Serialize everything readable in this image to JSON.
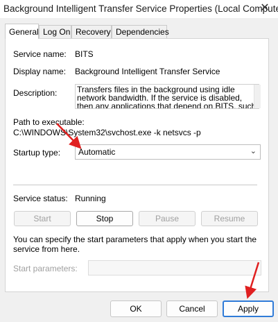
{
  "window": {
    "title": "Background Intelligent Transfer Service Properties (Local Computer)",
    "close_icon": "close-icon"
  },
  "tabs": [
    {
      "label": "General"
    },
    {
      "label": "Log On"
    },
    {
      "label": "Recovery"
    },
    {
      "label": "Dependencies"
    }
  ],
  "general": {
    "service_name_label": "Service name:",
    "service_name": "BITS",
    "display_name_label": "Display name:",
    "display_name": "Background Intelligent Transfer Service",
    "description_label": "Description:",
    "description": "Transfers files in the background using idle network bandwidth. If the service is disabled, then any applications that depend on BITS, such as Windows",
    "path_label": "Path to executable:",
    "path": "C:\\WINDOWS\\System32\\svchost.exe -k netsvcs -p",
    "startup_label": "Startup type:",
    "startup_value": "Automatic",
    "status_label": "Service status:",
    "status_value": "Running",
    "buttons": {
      "start": "Start",
      "stop": "Stop",
      "pause": "Pause",
      "resume": "Resume"
    },
    "info_text": "You can specify the start parameters that apply when you start the service from here.",
    "params_label": "Start parameters:",
    "params_value": ""
  },
  "footer": {
    "ok": "OK",
    "cancel": "Cancel",
    "apply": "Apply"
  },
  "colors": {
    "annotation_arrow": "#e02020",
    "focus_border": "#2f7bd8"
  }
}
